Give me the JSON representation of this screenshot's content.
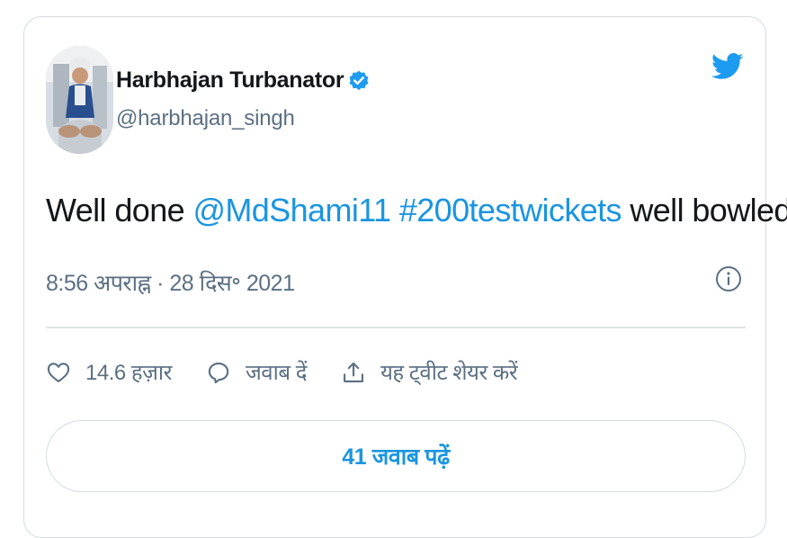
{
  "user": {
    "display_name": "Harbhajan Turbanator",
    "handle": "@harbhajan_singh",
    "verified": true
  },
  "tweet": {
    "text_prefix": "Well done ",
    "mention": "@MdShami11",
    "text_space": " ",
    "hashtag": "#200testwickets",
    "text_suffix": " well bowled",
    "timestamp": "8:56 अपराह्न · 28 दिस॰ 2021"
  },
  "actions": {
    "likes": "14.6 हज़ार",
    "reply": "जवाब दें",
    "share": "यह ट्वीट शेयर करें"
  },
  "replies_button": "41 जवाब पढ़ें",
  "colors": {
    "brand_blue": "#1d9bf0",
    "link_blue": "#1b95e0",
    "text": "#14171a",
    "muted": "#5b7083",
    "border": "#d4dbe1"
  },
  "icons": [
    "verified-icon",
    "twitter-bird-icon",
    "info-icon",
    "heart-icon",
    "reply-bubble-icon",
    "share-icon"
  ]
}
